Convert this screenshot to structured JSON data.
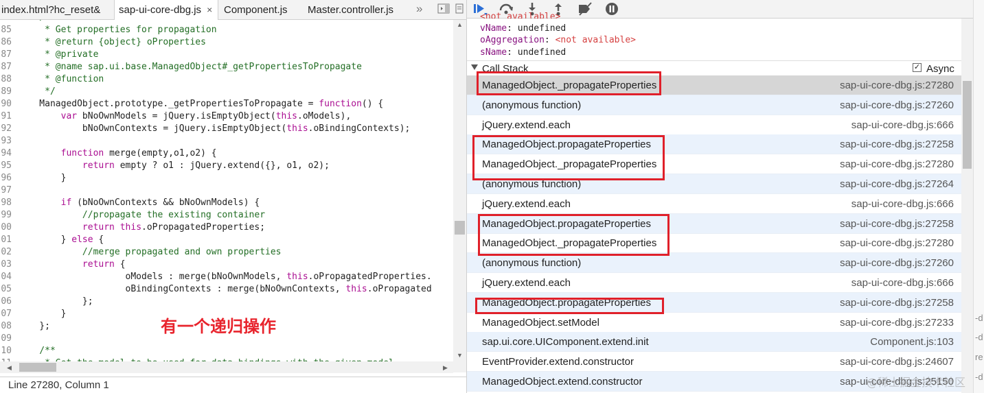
{
  "editor": {
    "tabs": [
      {
        "label": "index.html?hc_reset&"
      },
      {
        "label": "sap-ui-core-dbg.js",
        "close": "×"
      },
      {
        "label": "Component.js"
      },
      {
        "label": "Master.controller.js"
      }
    ],
    "overflow_glyph": "»",
    "lines": [
      {
        "n": "84",
        "t": "    /**",
        "k": "cm"
      },
      {
        "n": "85",
        "t": "     * Get properties for propagation",
        "k": "cm"
      },
      {
        "n": "86",
        "t": "     * @return {object} oProperties",
        "k": "cm"
      },
      {
        "n": "87",
        "t": "     * @private",
        "k": "cm"
      },
      {
        "n": "87",
        "t": "     * @name sap.ui.base.ManagedObject#_getPropertiesToPropagate",
        "k": "cm"
      },
      {
        "n": "88",
        "t": "     * @function",
        "k": "cm"
      },
      {
        "n": "89",
        "t": "     */",
        "k": "cm"
      },
      {
        "n": "90",
        "t": "    ManagedObject.prototype._getPropertiesToPropagate = function() {",
        "k": "code"
      },
      {
        "n": "91",
        "t": "        var bNoOwnModels = jQuery.isEmptyObject(this.oModels),",
        "k": "code"
      },
      {
        "n": "92",
        "t": "            bNoOwnContexts = jQuery.isEmptyObject(this.oBindingContexts);",
        "k": "code"
      },
      {
        "n": "93",
        "t": "",
        "k": "code"
      },
      {
        "n": "94",
        "t": "        function merge(empty,o1,o2) {",
        "k": "code"
      },
      {
        "n": "95",
        "t": "            return empty ? o1 : jQuery.extend({}, o1, o2);",
        "k": "code"
      },
      {
        "n": "96",
        "t": "        }",
        "k": "code"
      },
      {
        "n": "97",
        "t": "",
        "k": "code"
      },
      {
        "n": "98",
        "t": "        if (bNoOwnContexts && bNoOwnModels) {",
        "k": "code"
      },
      {
        "n": "99",
        "t": "            //propagate the existing container",
        "k": "cm"
      },
      {
        "n": "00",
        "t": "            return this.oPropagatedProperties;",
        "k": "code"
      },
      {
        "n": "01",
        "t": "        } else {",
        "k": "code"
      },
      {
        "n": "02",
        "t": "            //merge propagated and own properties",
        "k": "cm"
      },
      {
        "n": "03",
        "t": "            return {",
        "k": "code"
      },
      {
        "n": "04",
        "t": "                    oModels : merge(bNoOwnModels, this.oPropagatedProperties.",
        "k": "code"
      },
      {
        "n": "05",
        "t": "                    oBindingContexts : merge(bNoOwnContexts, this.oPropagated",
        "k": "code"
      },
      {
        "n": "06",
        "t": "            };",
        "k": "code"
      },
      {
        "n": "07",
        "t": "        }",
        "k": "code"
      },
      {
        "n": "08",
        "t": "    };",
        "k": "code"
      },
      {
        "n": "09",
        "t": "",
        "k": "code"
      },
      {
        "n": "10",
        "t": "    /**",
        "k": "cm"
      },
      {
        "n": "11",
        "t": "     * Get the model to be used for data bindings with the given model",
        "k": "cm"
      }
    ],
    "annotation": "有一个递归操作",
    "status": "Line 27280, Column 1"
  },
  "scope": {
    "rows": [
      {
        "key": "",
        "val": "",
        "na": "<not available>"
      },
      {
        "key": "vName",
        "val": "undefined",
        "na": ""
      },
      {
        "key": "oAggregation",
        "val": "",
        "na": "<not available>"
      },
      {
        "key": "sName",
        "val": "undefined",
        "na": ""
      }
    ]
  },
  "callstack": {
    "title": "Call Stack",
    "async_label": "Async",
    "async_checked": "✓",
    "frames": [
      {
        "fn": "ManagedObject._propagateProperties",
        "loc": "sap-ui-core-dbg.js:27280"
      },
      {
        "fn": "(anonymous function)",
        "loc": "sap-ui-core-dbg.js:27260"
      },
      {
        "fn": "jQuery.extend.each",
        "loc": "sap-ui-core-dbg.js:666"
      },
      {
        "fn": "ManagedObject.propagateProperties",
        "loc": "sap-ui-core-dbg.js:27258"
      },
      {
        "fn": "ManagedObject._propagateProperties",
        "loc": "sap-ui-core-dbg.js:27280"
      },
      {
        "fn": "(anonymous function)",
        "loc": "sap-ui-core-dbg.js:27264"
      },
      {
        "fn": "jQuery.extend.each",
        "loc": "sap-ui-core-dbg.js:666"
      },
      {
        "fn": "ManagedObject.propagateProperties",
        "loc": "sap-ui-core-dbg.js:27258"
      },
      {
        "fn": "ManagedObject._propagateProperties",
        "loc": "sap-ui-core-dbg.js:27280"
      },
      {
        "fn": "(anonymous function)",
        "loc": "sap-ui-core-dbg.js:27260"
      },
      {
        "fn": "jQuery.extend.each",
        "loc": "sap-ui-core-dbg.js:666"
      },
      {
        "fn": "ManagedObject.propagateProperties",
        "loc": "sap-ui-core-dbg.js:27258"
      },
      {
        "fn": "ManagedObject.setModel",
        "loc": "sap-ui-core-dbg.js:27233"
      },
      {
        "fn": "sap.ui.core.UIComponent.extend.init",
        "loc": "Component.js:103"
      },
      {
        "fn": "EventProvider.extend.constructor",
        "loc": "sap-ui-core-dbg.js:24607"
      },
      {
        "fn": "ManagedObject.extend.constructor",
        "loc": "sap-ui-core-dbg.js:25150"
      }
    ]
  },
  "edge_text": [
    "-d",
    "-d",
    "re",
    "-d"
  ],
  "watermark": "@稀土掘金技术社区",
  "colors": {
    "highlight": "#e0202a",
    "annotation": "#e8232c",
    "selected_row": "#d6d6d6",
    "alt_row": "#eaf2fc"
  }
}
